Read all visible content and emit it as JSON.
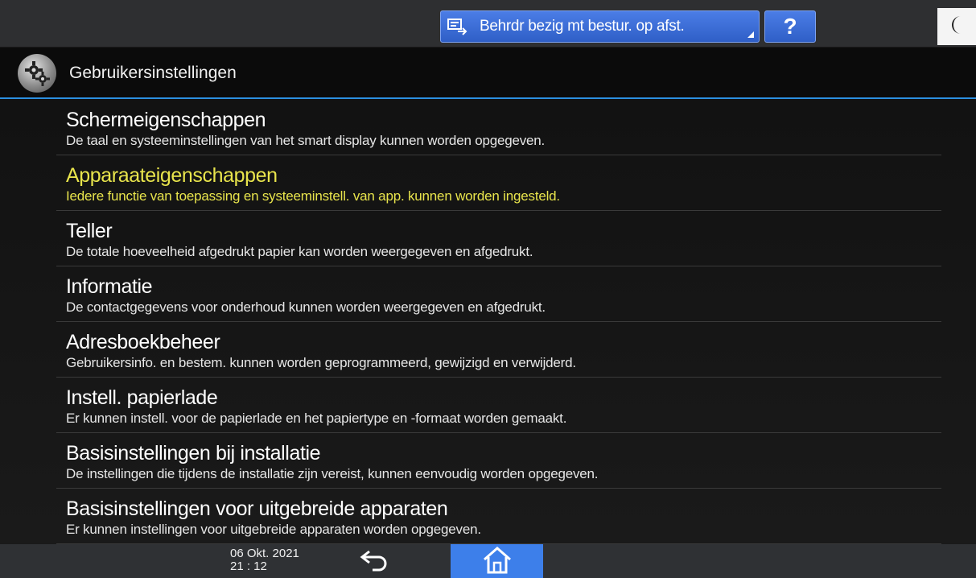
{
  "topbar": {
    "remote_label": "Behrdr bezig mt bestur. op afst.",
    "help_label": "?",
    "remote_icon": "remote-control-icon",
    "mode_icon": "moon-icon"
  },
  "title": {
    "text": "Gebruikersinstellingen",
    "icon": "gear-settings-icon"
  },
  "menu": {
    "items": [
      {
        "title": "Schermeigenschappen",
        "desc": "De taal en systeeminstellingen van het smart display kunnen worden opgegeven."
      },
      {
        "title": "Apparaateigenschappen",
        "desc": "Iedere functie van toepassing en systeeminstell. van app. kunnen worden ingesteld."
      },
      {
        "title": "Teller",
        "desc": "De totale hoeveelheid afgedrukt papier kan worden weergegeven en afgedrukt."
      },
      {
        "title": "Informatie",
        "desc": "De contactgegevens voor onderhoud kunnen worden weergegeven en afgedrukt."
      },
      {
        "title": "Adresboekbeheer",
        "desc": "Gebruikersinfo. en bestem. kunnen worden geprogrammeerd, gewijzigd en verwijderd."
      },
      {
        "title": "Instell. papierlade",
        "desc": "Er kunnen instell. voor de papierlade en het papiertype en -formaat worden gemaakt."
      },
      {
        "title": "Basisinstellingen bij installatie",
        "desc": "De instellingen die tijdens de installatie zijn vereist, kunnen eenvoudig worden opgegeven."
      },
      {
        "title": "Basisinstellingen voor uitgebreide apparaten",
        "desc": "Er kunnen instellingen voor uitgebreide apparaten worden opgegeven."
      }
    ],
    "highlight_color": "#e8e44c"
  },
  "bottombar": {
    "date": "06 Okt. 2021",
    "time": "21 : 12",
    "back_icon": "back-arrow-icon",
    "home_icon": "home-icon",
    "home_color": "#3d7fea"
  }
}
